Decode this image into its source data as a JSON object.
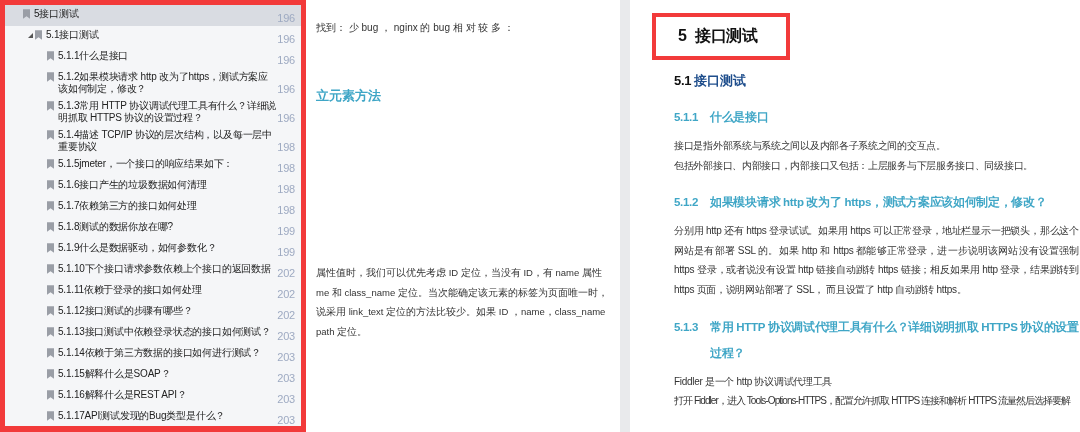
{
  "bookmarks": [
    {
      "title": "5接口测试",
      "page": "196",
      "selected": true,
      "children": [
        {
          "title": "5.1接口测试",
          "page": "196",
          "selected": false,
          "expanded": true,
          "children": [
            {
              "title": "5.1.1什么是接口",
              "page": "196",
              "selected": false
            },
            {
              "title": "5.1.2如果模块请求 http 改为了https，测试方案应该如何制定，修改？",
              "page": "196",
              "selected": false
            },
            {
              "title": "5.1.3常用 HTTP 协议调试代理工具有什么？详细说明抓取 HTTPS 协议的设置过程？",
              "page": "196",
              "selected": false
            },
            {
              "title": "5.1.4描述 TCP/IP 协议的层次结构，以及每一层中重要协议",
              "page": "198",
              "selected": false
            },
            {
              "title": "5.1.5jmeter，一个接口的响应结果如下：",
              "page": "198",
              "selected": false
            },
            {
              "title": "5.1.6接口产生的垃圾数据如何清理",
              "page": "198",
              "selected": false
            },
            {
              "title": "5.1.7依赖第三方的接口如何处理",
              "page": "198",
              "selected": false
            },
            {
              "title": "5.1.8测试的数据你放在哪?",
              "page": "199",
              "selected": false
            },
            {
              "title": "5.1.9什么是数据驱动，如何参数化？",
              "page": "199",
              "selected": false
            },
            {
              "title": "5.1.10下个接口请求参数依赖上个接口的返回数据",
              "page": "202",
              "selected": false
            },
            {
              "title": "5.1.11依赖于登录的接口如何处理",
              "page": "202",
              "selected": false
            },
            {
              "title": "5.1.12接口测试的步骤有哪些？",
              "page": "202",
              "selected": false
            },
            {
              "title": "5.1.13接口测试中依赖登录状态的接口如何测试？",
              "page": "203",
              "selected": false
            },
            {
              "title": "5.1.14依赖于第三方数据的接口如何进行测试？",
              "page": "203",
              "selected": false
            },
            {
              "title": "5.1.15解释什么是SOAP？",
              "page": "203",
              "selected": false
            },
            {
              "title": "5.1.16解释什么是REST API？",
              "page": "203",
              "selected": false
            },
            {
              "title": "5.1.17API测试发现的Bug类型是什么？",
              "page": "203",
              "selected": false
            }
          ]
        }
      ]
    }
  ],
  "left_page": {
    "line_1": "找到： 少 bug ， nginx 的 bug 相 对 较 多 ：",
    "heading": "立元素方法",
    "paragraph": [
      "属性值时，我们可以优先考虑 ID 定位，当没有 ID，有 name 属性",
      "me 和 class_name 定位。当次能确定该元素的标签为页面唯一时，",
      "说采用 link_text 定位的方法比较少。如果 ID ，name，class_name",
      "path 定位。"
    ]
  },
  "right_page": {
    "chapter_number": "5",
    "chapter_title": "接口测试",
    "section_number": "5.1",
    "section_title": "接口测试",
    "blocks": [
      {
        "kind": "heading",
        "number": "5.1.1",
        "text": "什么是接口"
      },
      {
        "kind": "para",
        "lines": [
          "接口是指外部系统与系统之间以及内部各子系统之间的交互点。"
        ]
      },
      {
        "kind": "para",
        "lines": [
          "包括外部接口、内部接口，内部接口又包括：上层服务与下层服务接口、同级接口。"
        ]
      },
      {
        "kind": "heading",
        "number": "5.1.2",
        "text": "如果模块请求 http 改为了 https，测试方案应该如何制定，修改？"
      },
      {
        "kind": "para",
        "lines": [
          "分别用 http 还有 https 登录试试。如果用 https 可以正常登录，地址栏显示一把锁头，那么这个网站是有部署 SSL 的。如果 http 和 https 都能够正常登录，进一步说明该网站没有设置强制 https 登录，或者说没有设置 http 链接自动跳转 https 链接；相反如果用 http 登录，结果跳转到 https 页面，说明网站部署了 SSL， 而且设置了 http 自动跳转 https。"
        ]
      },
      {
        "kind": "heading",
        "number": "5.1.3",
        "text": "常用 HTTP 协议调试代理工具有什么？详细说明抓取 HTTPS 协议的设置过程？"
      },
      {
        "kind": "para",
        "lines": [
          "Fiddler 是一个 http 协议调试代理工具"
        ]
      },
      {
        "kind": "para",
        "lines": [
          "打开 Fiddler，进入 Tools-Options-HTTPS，配置允许抓取 HTTPS 连接和解析 HTTPS 流量然后选择要解"
        ]
      }
    ]
  }
}
